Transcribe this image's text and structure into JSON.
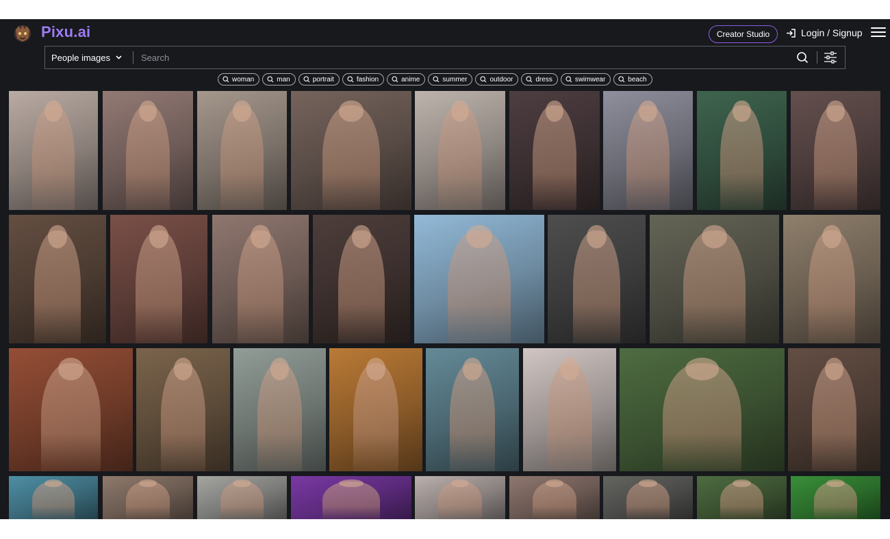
{
  "header": {
    "brand": "Pixu.ai",
    "creator_studio": "Creator Studio",
    "login": "Login / Signup"
  },
  "search": {
    "category": "People images",
    "placeholder": "Search"
  },
  "tags": [
    "woman",
    "man",
    "portrait",
    "fashion",
    "anime",
    "summer",
    "outdoor",
    "dress",
    "swimwear",
    "beach"
  ],
  "colors": {
    "background": "#17191d",
    "brand": "#9e7cf2",
    "accent_border": "#8f5ce8"
  },
  "gallery": {
    "rows": [
      {
        "photos": [
          "#8a7f79",
          "#6d5a56",
          "#7a7068",
          "#574a44",
          "#8d8580",
          "#3a2e30",
          "#6a6a74",
          "#2e4a3a",
          "#4a3b3a"
        ]
      },
      {
        "photos": [
          "#4a3a30",
          "#5a3b35",
          "#6a5852",
          "#3a2e2c",
          "#6d8aa0",
          "#3a3a3a",
          "#4a4a40",
          "#6a5e50"
        ]
      },
      {
        "photos": [
          "#6e3a28",
          "#5b4a38",
          "#6c7470",
          "#8a5a28",
          "#4a6670",
          "#9a9290",
          "#3a5030",
          "#4a3a32"
        ]
      },
      {
        "photos": [
          "#3a6a7a",
          "#6a5a50",
          "#7a7a78",
          "#5a2a7a",
          "#8a8280",
          "#6a5852",
          "#4a4a48",
          "#3a5030",
          "#2a6a2a"
        ]
      }
    ]
  }
}
